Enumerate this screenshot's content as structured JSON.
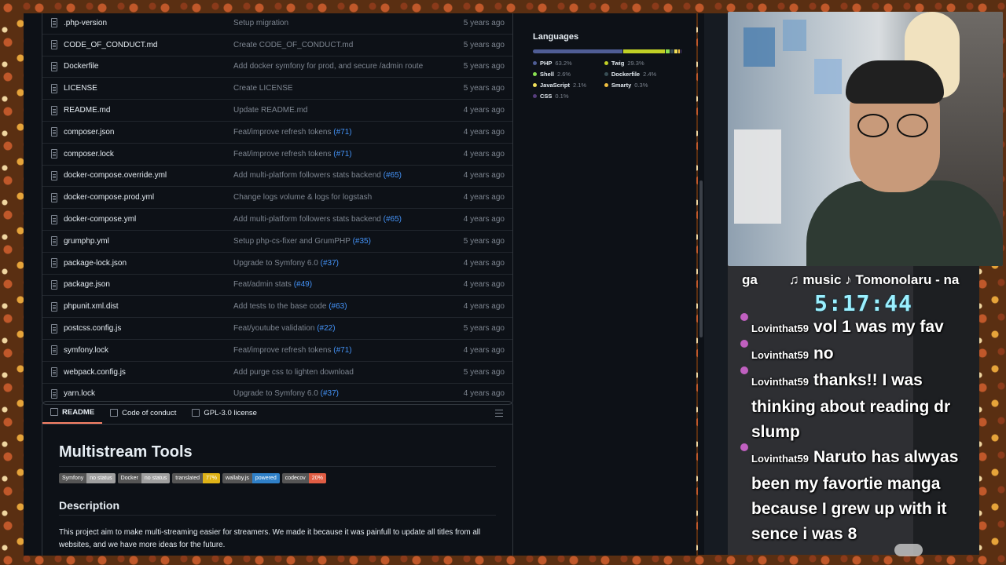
{
  "files": [
    {
      "name": ".php-version",
      "message": "Setup migration",
      "pr": "",
      "age": "5 years ago"
    },
    {
      "name": "CODE_OF_CONDUCT.md",
      "message": "Create CODE_OF_CONDUCT.md",
      "pr": "",
      "age": "5 years ago"
    },
    {
      "name": "Dockerfile",
      "message": "Add docker symfony for prod, and secure /admin route",
      "pr": "",
      "age": "5 years ago"
    },
    {
      "name": "LICENSE",
      "message": "Create LICENSE",
      "pr": "",
      "age": "5 years ago"
    },
    {
      "name": "README.md",
      "message": "Update README.md",
      "pr": "",
      "age": "4 years ago"
    },
    {
      "name": "composer.json",
      "message": "Feat/improve refresh tokens",
      "pr": "(#71)",
      "age": "4 years ago"
    },
    {
      "name": "composer.lock",
      "message": "Feat/improve refresh tokens",
      "pr": "(#71)",
      "age": "4 years ago"
    },
    {
      "name": "docker-compose.override.yml",
      "message": "Add multi-platform followers stats backend",
      "pr": "(#65)",
      "age": "4 years ago"
    },
    {
      "name": "docker-compose.prod.yml",
      "message": "Change logs volume & logs for logstash",
      "pr": "",
      "age": "4 years ago"
    },
    {
      "name": "docker-compose.yml",
      "message": "Add multi-platform followers stats backend",
      "pr": "(#65)",
      "age": "4 years ago"
    },
    {
      "name": "grumphp.yml",
      "message": "Setup php-cs-fixer and GrumPHP",
      "pr": "(#35)",
      "age": "5 years ago"
    },
    {
      "name": "package-lock.json",
      "message": "Upgrade to Symfony 6.0",
      "pr": "(#37)",
      "age": "4 years ago"
    },
    {
      "name": "package.json",
      "message": "Feat/admin stats",
      "pr": "(#49)",
      "age": "4 years ago"
    },
    {
      "name": "phpunit.xml.dist",
      "message": "Add tests to the base code",
      "pr": "(#63)",
      "age": "4 years ago"
    },
    {
      "name": "postcss.config.js",
      "message": "Feat/youtube validation",
      "pr": "(#22)",
      "age": "5 years ago"
    },
    {
      "name": "symfony.lock",
      "message": "Feat/improve refresh tokens",
      "pr": "(#71)",
      "age": "4 years ago"
    },
    {
      "name": "webpack.config.js",
      "message": "Add purge css to lighten download",
      "pr": "",
      "age": "5 years ago"
    },
    {
      "name": "yarn.lock",
      "message": "Upgrade to Symfony 6.0",
      "pr": "(#37)",
      "age": "4 years ago"
    }
  ],
  "languages": {
    "title": "Languages",
    "items": [
      {
        "name": "PHP",
        "pct": "63.2%",
        "value": 63.2,
        "color": "#4F5D95"
      },
      {
        "name": "Twig",
        "pct": "29.3%",
        "value": 29.3,
        "color": "#c1d026"
      },
      {
        "name": "Shell",
        "pct": "2.6%",
        "value": 2.6,
        "color": "#89e051"
      },
      {
        "name": "Dockerfile",
        "pct": "2.4%",
        "value": 2.4,
        "color": "#384d54"
      },
      {
        "name": "JavaScript",
        "pct": "2.1%",
        "value": 2.1,
        "color": "#f1e05a"
      },
      {
        "name": "Smarty",
        "pct": "0.3%",
        "value": 0.3,
        "color": "#f0c040"
      },
      {
        "name": "CSS",
        "pct": "0.1%",
        "value": 0.1,
        "color": "#563d7c"
      }
    ]
  },
  "readme": {
    "tabs": [
      "README",
      "Code of conduct",
      "GPL-3.0 license"
    ],
    "title": "Multistream Tools",
    "badges": [
      {
        "label": "Symfony",
        "value": "no status",
        "color": "#9f9f9f"
      },
      {
        "label": "Docker",
        "value": "no status",
        "color": "#9f9f9f"
      },
      {
        "label": "translated",
        "value": "77%",
        "color": "#dfb317"
      },
      {
        "label": "wallaby.js",
        "value": "powered",
        "color": "#2f80c8"
      },
      {
        "label": "codecov",
        "value": "20%",
        "color": "#e05d44"
      }
    ],
    "description_heading": "Description",
    "description": "This project aim to make multi-streaming easier for streamers. We made it because it was painfull to update all titles from all websites, and we have more ideas for the future."
  },
  "stream": {
    "marquee_left": "ga",
    "marquee": "♫ music ♪ Tomonolaru - na",
    "timer": "5:17:44",
    "chat": [
      {
        "user": "Lovinthat59",
        "text": "vol 1 was my fav"
      },
      {
        "user": "Lovinthat59",
        "text": "no"
      },
      {
        "user": "Lovinthat59",
        "text": "thanks!! I was thinking about reading dr slump"
      },
      {
        "user": "Lovinthat59",
        "text": "Naruto has alwyas been my favortie manga because I grew up with it sence i was 8"
      }
    ]
  }
}
